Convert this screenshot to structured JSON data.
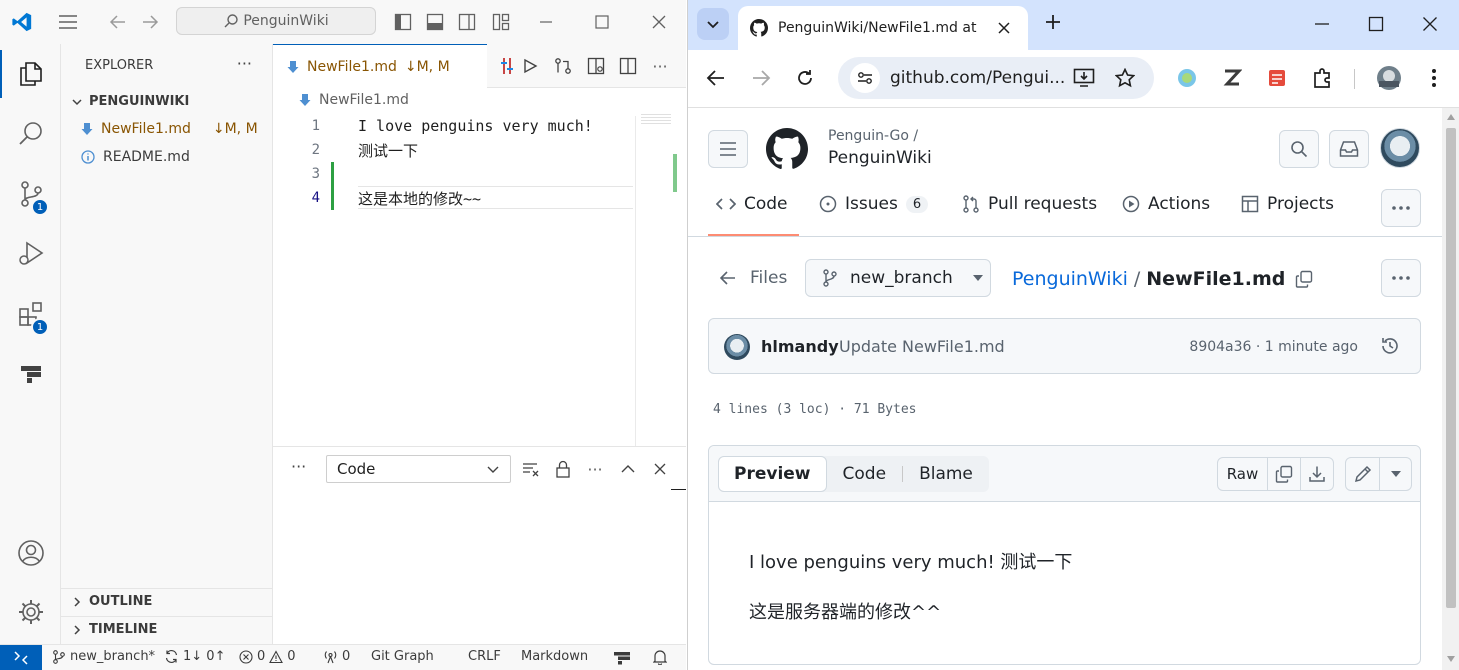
{
  "vscode": {
    "search_text": "PenguinWiki",
    "sidebar": {
      "title": "EXPLORER",
      "folder": "PENGUINWIKI",
      "files": [
        {
          "name": "NewFile1.md",
          "status": "↓M, M"
        },
        {
          "name": "README.md",
          "status": ""
        }
      ],
      "outline": "OUTLINE",
      "timeline": "TIMELINE"
    },
    "badges": {
      "scm": "1",
      "extensions": "1"
    },
    "tab": {
      "label": "NewFile1.md",
      "status": "↓M, M"
    },
    "breadcrumb": "NewFile1.md",
    "lines": [
      {
        "n": "1",
        "text": "I love penguins very much!"
      },
      {
        "n": "2",
        "text": "测试一下"
      },
      {
        "n": "3",
        "text": ""
      },
      {
        "n": "4",
        "text": "这是本地的修改~~"
      }
    ],
    "panel": {
      "select_value": "Code"
    },
    "status": {
      "branch": "new_branch*",
      "sync": "1↓ 0↑",
      "errors": "0",
      "warnings": "0",
      "ports": "0",
      "git_graph": "Git Graph",
      "eol": "CRLF",
      "language": "Markdown"
    }
  },
  "chrome": {
    "tab_title": "PenguinWiki/NewFile1.md at",
    "url": "github.com/Pengui..."
  },
  "github": {
    "owner": "Penguin-Go /",
    "repo": "PenguinWiki",
    "nav": {
      "code": "Code",
      "issues": "Issues",
      "issues_count": "6",
      "pulls": "Pull requests",
      "actions": "Actions",
      "projects": "Projects"
    },
    "files_label": "Files",
    "branch": "new_branch",
    "path_repo": "PenguinWiki",
    "path_sep": "/",
    "path_file": "NewFile1.md",
    "commit": {
      "author": "hlmandy",
      "message": "Update NewFile1.md",
      "meta": "8904a36 · 1 minute ago"
    },
    "file_info": "4 lines (3 loc) · 71 Bytes",
    "view_tabs": {
      "preview": "Preview",
      "code": "Code",
      "blame": "Blame"
    },
    "raw": "Raw",
    "content": {
      "line1": "I love penguins very much! 测试一下",
      "line2": "这是服务器端的修改^^"
    }
  }
}
